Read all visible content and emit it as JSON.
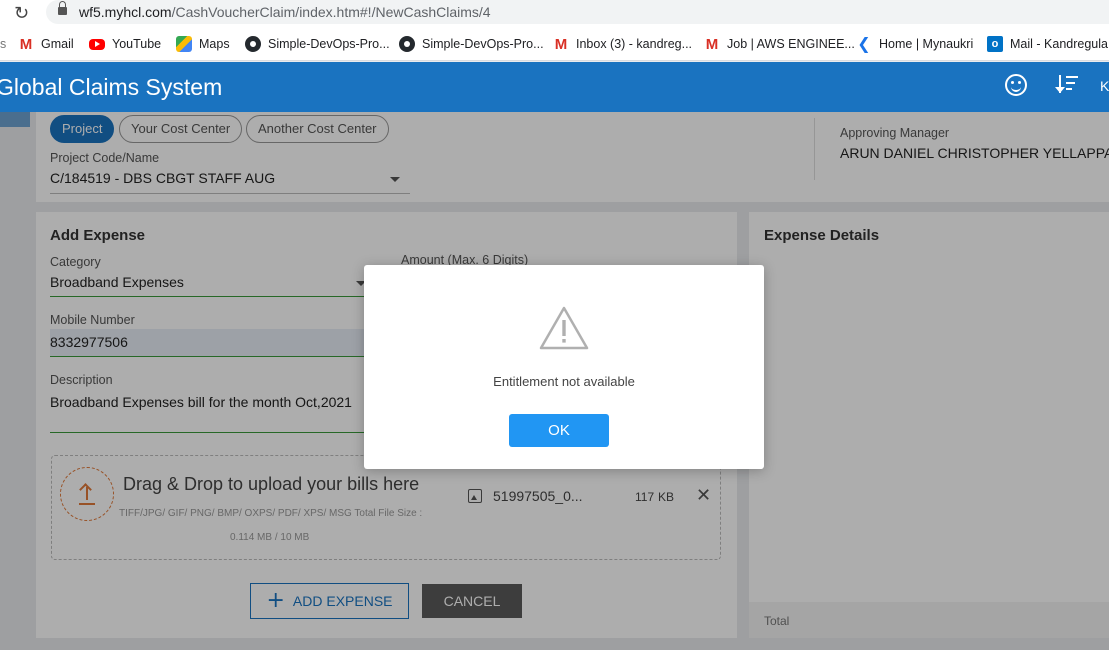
{
  "browser": {
    "url_host": "wf5.myhcl.com",
    "url_path": "/CashVoucherClaim/index.htm#!/NewCashClaims/4",
    "bookmarks": [
      {
        "label": "Gmail",
        "icon": "gmail-icon"
      },
      {
        "label": "YouTube",
        "icon": "youtube-icon"
      },
      {
        "label": "Maps",
        "icon": "maps-icon"
      },
      {
        "label": "Simple-DevOps-Pro...",
        "icon": "github-icon"
      },
      {
        "label": "Simple-DevOps-Pro...",
        "icon": "github-icon"
      },
      {
        "label": "Inbox (3) - kandreg...",
        "icon": "gmail-icon"
      },
      {
        "label": "Job | AWS ENGINEE...",
        "icon": "gmail-icon"
      },
      {
        "label": "Home | Mynaukri",
        "icon": "naukri-icon"
      },
      {
        "label": "Mail - Kandregula",
        "icon": "outlook-icon"
      }
    ]
  },
  "app": {
    "title": "Global Claims System",
    "user_initial": "K"
  },
  "cost_center": {
    "tabs": [
      "Project",
      "Your Cost Center",
      "Another Cost Center"
    ],
    "active_tab": "Project",
    "project_label": "Project Code/Name",
    "project_value": "C/184519 - DBS CBGT STAFF AUG",
    "approver_label": "Approving Manager",
    "approver_value": "ARUN DANIEL CHRISTOPHER YELLAPPAN"
  },
  "add_expense": {
    "title": "Add Expense",
    "category_label": "Category",
    "category_value": "Broadband Expenses",
    "amount_label": "Amount (Max. 6 Digits)",
    "mobile_label": "Mobile Number",
    "mobile_value": "8332977506",
    "description_label": "Description",
    "description_value": "Broadband Expenses bill for the month Oct,2021",
    "drop_text": "Drag & Drop to upload your bills here",
    "formats_hint": "TIFF/JPG/ GIF/ PNG/ BMP/ OXPS/ PDF/ XPS/ MSG Total File Size :",
    "size_hint": "0.114 MB / 10 MB",
    "file_name": "51997505_0...",
    "file_size_num": "117",
    "file_size_unit": "KB",
    "add_button": "ADD EXPENSE",
    "cancel_button": "CANCEL"
  },
  "expense_details": {
    "title": "Expense Details",
    "total_label": "Total"
  },
  "modal": {
    "message": "Entitlement not available",
    "ok_label": "OK"
  },
  "colors": {
    "header": "#1a73c0",
    "ok_button": "#2196f3",
    "cancel_button": "#5a5a5a",
    "upload_accent": "#e07a3a"
  }
}
